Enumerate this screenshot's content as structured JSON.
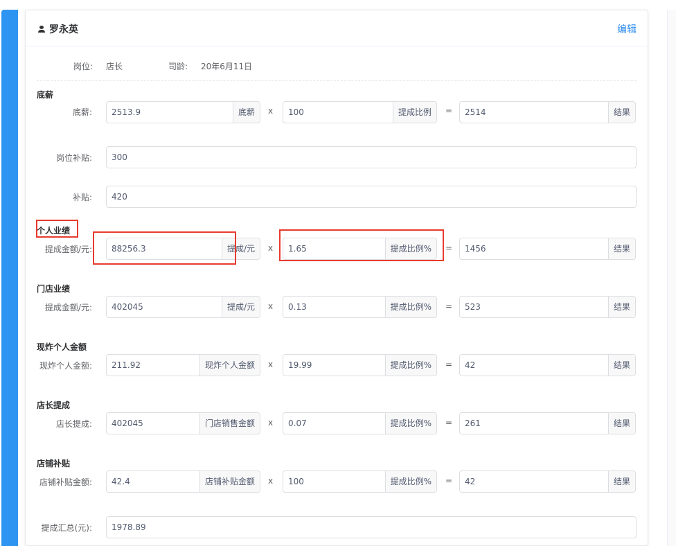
{
  "header": {
    "user_name": "罗永英",
    "edit_label": "编辑",
    "position_label": "岗位:",
    "position_value": "店长",
    "seniority_label": "司龄:",
    "seniority_value": "20年6月11日"
  },
  "operators": {
    "multiply": "x",
    "equals": "="
  },
  "sections": {
    "base": {
      "title": "底薪",
      "label": "底薪:",
      "input": "2513.9",
      "input_addon": "底薪",
      "rate": "100",
      "rate_addon": "提成比例",
      "result": "2514",
      "result_addon": "结果"
    },
    "post_allowance": {
      "label": "岗位补贴:",
      "value": "300"
    },
    "allowance": {
      "label": "补贴:",
      "value": "420"
    },
    "personal": {
      "title": "个人业绩",
      "label": "提成金额/元:",
      "input": "88256.3",
      "input_addon": "提成/元",
      "rate": "1.65",
      "rate_addon": "提成比例%",
      "result": "1456",
      "result_addon": "结果"
    },
    "store": {
      "title": "门店业绩",
      "label": "提成金额/元:",
      "input": "402045",
      "input_addon": "提成/元",
      "rate": "0.13",
      "rate_addon": "提成比例%",
      "result": "523",
      "result_addon": "结果"
    },
    "fried": {
      "title": "现炸个人金额",
      "label": "现炸个人金额:",
      "input": "211.92",
      "input_addon": "现炸个人金额",
      "rate": "19.99",
      "rate_addon": "提成比例%",
      "result": "42",
      "result_addon": "结果"
    },
    "manager": {
      "title": "店长提成",
      "label": "店长提成:",
      "input": "402045",
      "input_addon": "门店销售金额",
      "rate": "0.07",
      "rate_addon": "提成比例%",
      "result": "261",
      "result_addon": "结果"
    },
    "shop_allowance": {
      "title": "店铺补贴",
      "label": "店铺补贴金额:",
      "input": "42.4",
      "input_addon": "店铺补贴金额",
      "rate": "100",
      "rate_addon": "提成比例%",
      "result": "42",
      "result_addon": "结果"
    },
    "total": {
      "label": "提成汇总(元):",
      "value": "1978.89"
    }
  },
  "colors": {
    "accent": "#2d94f2",
    "link": "#2d8cf0",
    "highlight": "#e83b2e"
  }
}
